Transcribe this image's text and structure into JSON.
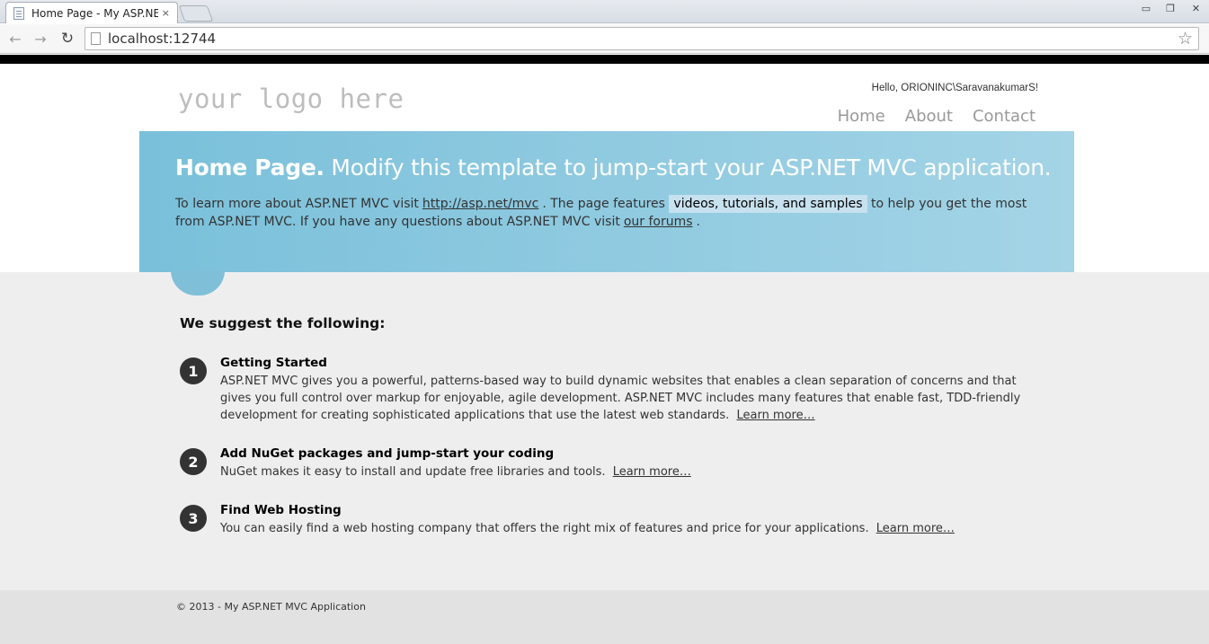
{
  "browser": {
    "tab_title": "Home Page - My ASP.NET",
    "tab_close": "×",
    "url": "localhost:12744",
    "window_controls": {
      "minimize": "▭",
      "maximize": "❐",
      "close": "✕"
    },
    "nav_icons": {
      "back": "back-arrow-icon",
      "forward": "forward-arrow-icon",
      "reload": "reload-icon",
      "bookmark": "star-icon"
    }
  },
  "header": {
    "logo": "your logo here",
    "greeting": "Hello, ORIONINC\\SaravanakumarS!",
    "nav": [
      {
        "label": "Home"
      },
      {
        "label": "About"
      },
      {
        "label": "Contact"
      }
    ]
  },
  "hero": {
    "title_strong": "Home Page.",
    "title_rest": "Modify this template to jump-start your ASP.NET MVC application.",
    "text1": "To learn more about ASP.NET MVC visit",
    "link1": "http://asp.net/mvc",
    "text2": ". The page features",
    "highlight": "videos, tutorials, and samples",
    "text3": "to help you get the most from ASP.NET MVC. If you have any questions about ASP.NET MVC visit",
    "link2": "our forums",
    "text4": "."
  },
  "main": {
    "heading": "We suggest the following:",
    "steps": [
      {
        "number": "1",
        "title": "Getting Started",
        "text": "ASP.NET MVC gives you a powerful, patterns-based way to build dynamic websites that enables a clean separation of concerns and that gives you full control over markup for enjoyable, agile development. ASP.NET MVC includes many features that enable fast, TDD-friendly development for creating sophisticated applications that use the latest web standards.",
        "link": "Learn more…"
      },
      {
        "number": "2",
        "title": "Add NuGet packages and jump-start your coding",
        "text": "NuGet makes it easy to install and update free libraries and tools.",
        "link": "Learn more…"
      },
      {
        "number": "3",
        "title": "Find Web Hosting",
        "text": "You can easily find a web hosting company that offers the right mix of features and price for your applications.",
        "link": "Learn more…"
      }
    ]
  },
  "footer": {
    "copyright": "© 2013 - My ASP.NET MVC Application"
  },
  "colors": {
    "hero_gradient_start": "#7ac0da",
    "hero_gradient_end": "#a4d4e6",
    "main_background": "#efeeef",
    "footer_background": "#e2e2e2",
    "step_number_background": "#333333"
  }
}
